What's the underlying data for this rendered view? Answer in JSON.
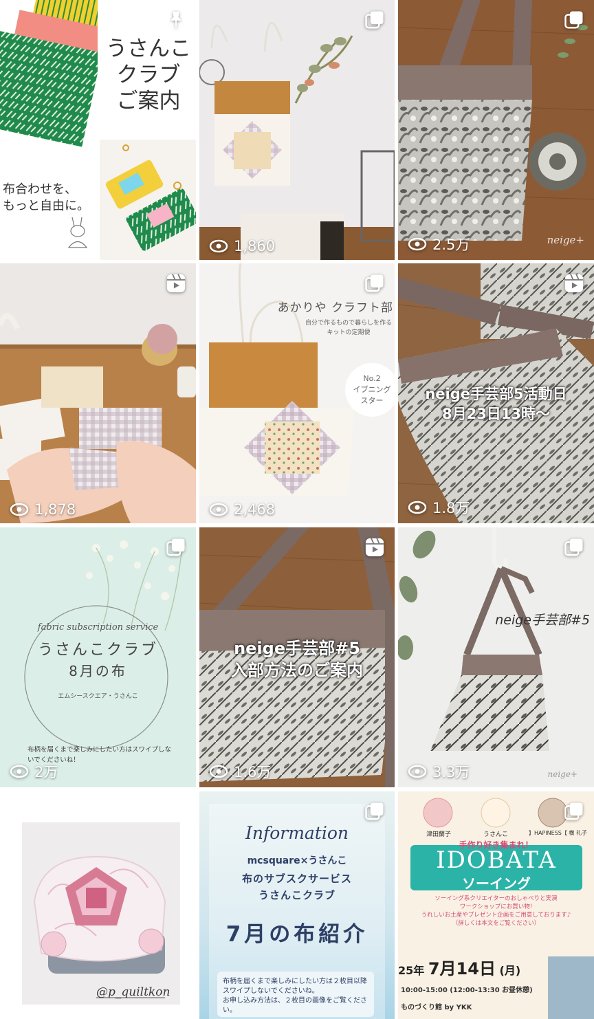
{
  "posts": [
    {
      "title_lines": [
        "うさんこ",
        "クラブ",
        "ご案内"
      ],
      "tagline_lines": [
        "布合わせを、",
        "もっと自由に。"
      ],
      "badge": "pin-icon"
    },
    {
      "views": "1,860",
      "badge": "carousel-icon"
    },
    {
      "views": "2.5万",
      "badge": "carousel-icon",
      "watermark": "neige+"
    },
    {
      "views": "1,878",
      "badge": "reel-icon"
    },
    {
      "views": "2,468",
      "badge": "carousel-icon",
      "header": "あかりや クラフト部",
      "subheader_lines": [
        "自分で作るもので暮らしを作る",
        "キットの定期便"
      ],
      "kit_lines": [
        "No.2",
        "イブニング",
        "スター"
      ]
    },
    {
      "views": "1.8万",
      "badge": "reel-icon",
      "caption_lines": [
        "neige手芸部5活動日",
        "8月23日13時〜"
      ]
    },
    {
      "views": "2万",
      "badge": "carousel-icon",
      "script": "fabric subscription service",
      "title": "うさんこクラブ",
      "subtitle": "8月の布",
      "brand": "エムシースクエア・うさんこ",
      "note": "布柄を届くまで楽しみにしたい方はスワイプしないでくださいね！"
    },
    {
      "views": "1.6万",
      "badge": "reel-icon",
      "caption_lines": [
        "neige手芸部#5",
        "入部方法のご案内"
      ]
    },
    {
      "views": "3.3万",
      "badge": "carousel-icon",
      "caption": "neige手芸部#5",
      "watermark": "neige+"
    },
    {
      "credit": "@p_quiltkon"
    },
    {
      "badge": "carousel-icon",
      "script": "Information",
      "brand": "mcsquare×うさんこ",
      "line1": "布のサブスクサービス",
      "line2": "うさんこクラブ",
      "headline": "7月の布紹介",
      "notes": [
        "布柄を届くまで楽しみにしたい方は２枚目以降スワイプしないでくださいね。",
        "お申し込み方法は、２枚目の画像をご覧ください。"
      ]
    },
    {
      "badge": "carousel-icon",
      "speakers": [
        "津田蘭子",
        "うさんこ",
        "】HAPINESS【 横 礼子"
      ],
      "banner_top": "手作り好き集まれ！",
      "banner_en": "IDOBATA",
      "banner_jp": "ソーイング",
      "desc_lines": [
        "ソーイング系クリエイターのおしゃべりと実演",
        "ワークショップにお買い物!",
        "うれしいお土産やプレゼント企画をご用意しております♪",
        "（詳しくは本文をご覧ください）"
      ],
      "date_year": "25年",
      "date_md": "7月14日",
      "date_dow": "(月)",
      "time_line": "10:00-15:00 (12:00-13:30 お昼休憩)",
      "venue": "ものづくり館 by YKK"
    }
  ],
  "colors": {
    "overlay_text": "#ffffff",
    "idobata_teal": "#2bb3a7",
    "info_navy": "#2e3f66",
    "mint_bg": "#dbeee7"
  }
}
